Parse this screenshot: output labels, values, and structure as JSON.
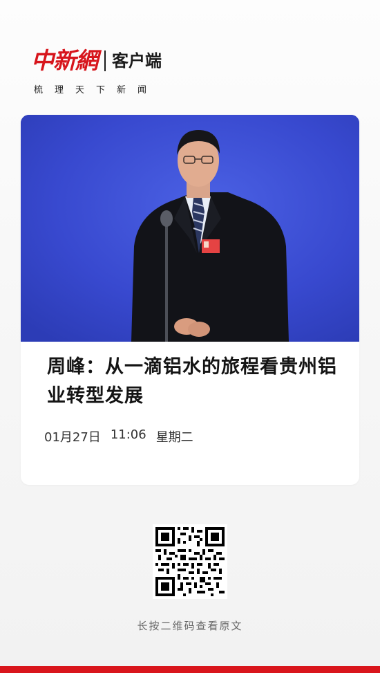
{
  "brand": {
    "logo_text": "中新網",
    "client_label": "客户端",
    "slogan": "梳理天下新闻"
  },
  "article": {
    "photo_icon": "news-photo-speaker-icon",
    "headline": "周峰：从一滴铝水的旅程看贵州铝业转型发展",
    "date": "01月27日",
    "time": "11:06",
    "weekday": "星期二"
  },
  "qr": {
    "icon": "qr-code-icon",
    "caption": "长按二维码查看原文"
  },
  "colors": {
    "brand_red": "#d7151c",
    "photo_blue": "#3a4ed2",
    "text_dark": "#141414",
    "caption_gray": "#666666"
  }
}
